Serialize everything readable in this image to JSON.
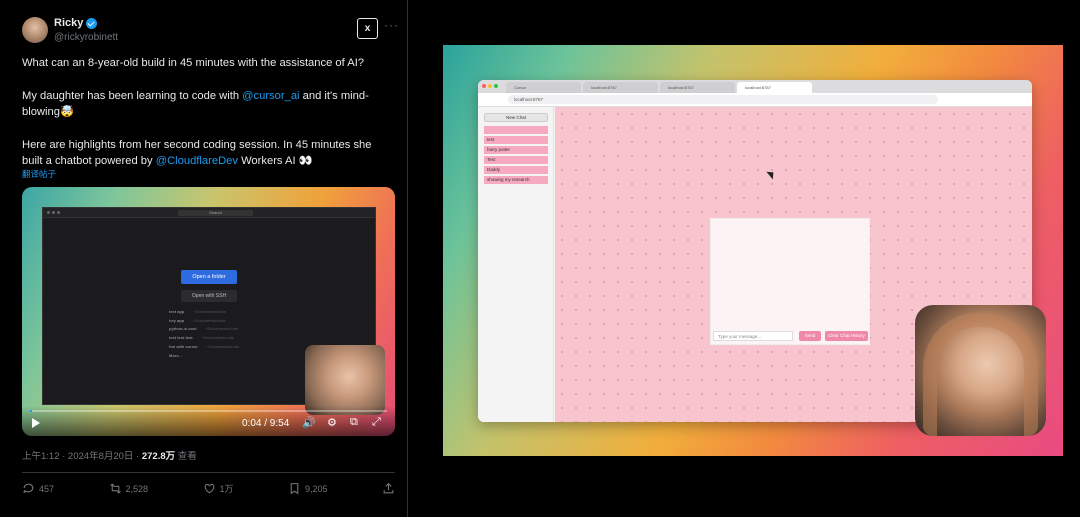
{
  "tweet": {
    "display_name": "Ricky",
    "handle": "@rickyrobinett",
    "grok_label": "x",
    "paragraphs": {
      "p1": "What can an 8-year-old build in 45 minutes with the assistance of AI?",
      "p2_pre": "My daughter has been learning to code with ",
      "p2_mention": "@cursor_ai",
      "p2_post": " and it's mind-blowing🤯",
      "p3_pre": "Here are highlights from her second coding session. In 45 minutes she built a chatbot powered by ",
      "p3_mention": "@CloudflareDev",
      "p3_post": " Workers AI 👀"
    },
    "translate": "翻译帖子",
    "timestamp": "上午1:12 · 2024年8月20日 · ",
    "views": "272.8万",
    "views_suffix": " 查看",
    "actions": {
      "replies": "457",
      "reposts": "2,528",
      "likes": "1万",
      "bookmarks": "9,205"
    }
  },
  "video": {
    "time": "0:04 / 9:54",
    "progress": 0.007,
    "inner": {
      "search": "Search",
      "open_folder": "Open a folder",
      "open_ssh": "Open with SSH",
      "recent": [
        {
          "name": "text app",
          "path": "~/Documents/code"
        },
        {
          "name": "hey app",
          "path": "~/Documents/code"
        },
        {
          "name": "python-is-cool",
          "path": "~/Documents/code"
        },
        {
          "name": "test test test",
          "path": "~/Documents/code"
        },
        {
          "name": "fun with cursor",
          "path": "~/Documents/code"
        },
        {
          "name": "More...",
          "path": ""
        }
      ]
    }
  },
  "screen": {
    "tabs": [
      "Cursor",
      "localhost:8787",
      "localhost:8787",
      "localhost:8787"
    ],
    "url": "localhost:8787",
    "new_chat": "New Chat",
    "chats": [
      "",
      "test",
      "harry potter",
      "Test",
      "Daddy",
      "showing my research"
    ],
    "message_placeholder": "Type your message...",
    "send_label": "Send",
    "clear_label": "Clear Chat History"
  },
  "colors": {
    "link": "#1d9bf0",
    "chat_accent": "#ee8aa8",
    "chat_item": "#f7a9c0"
  }
}
